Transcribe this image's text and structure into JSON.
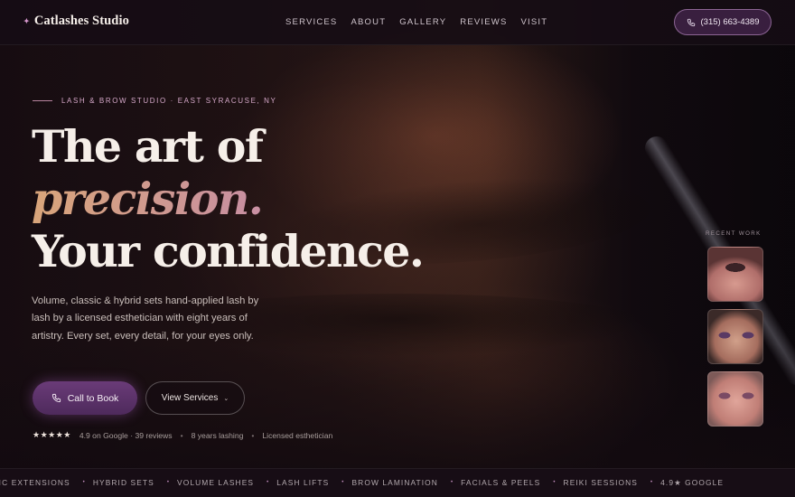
{
  "nav": {
    "brand_mark": "✦",
    "brand": "Catlashes Studio",
    "links": [
      "SERVICES",
      "ABOUT",
      "GALLERY",
      "REVIEWS",
      "VISIT"
    ],
    "phone": "(315) 663-4389"
  },
  "hero": {
    "eyebrow": "LASH & BROW STUDIO · EAST SYRACUSE, NY",
    "headline_1": "The art of",
    "headline_accent": "precision.",
    "headline_3": "Your confidence.",
    "lead": "Volume, classic & hybrid sets hand-applied lash by lash by a licensed esthetician with eight years of artistry. Every set, every detail, for your eyes only.",
    "cta_primary": "Call to Book",
    "cta_secondary": "View Services",
    "proof": {
      "stars": "★★★★★",
      "rating": "4.9 on Google · 39 reviews",
      "experience": "8 years lashing",
      "license": "Licensed esthetician"
    }
  },
  "recent_work": {
    "label": "RECENT WORK",
    "thumbs": [
      "recent-work-1",
      "recent-work-2",
      "recent-work-3"
    ]
  },
  "marquee": {
    "items": [
      "SIC EXTENSIONS",
      "HYBRID SETS",
      "VOLUME LASHES",
      "LASH LIFTS",
      "BROW LAMINATION",
      "FACIALS & PEELS",
      "REIKI SESSIONS",
      "4.9★ GOOGLE"
    ],
    "separator": "•"
  },
  "colors": {
    "accent_purple": "#6a3b78",
    "accent_gold": "#d9a57a",
    "accent_pink": "#e6a2de",
    "background": "#120b11"
  },
  "icons": {
    "phone": "phone-icon",
    "chevron": "chevron-down-icon",
    "star": "star-icon"
  }
}
